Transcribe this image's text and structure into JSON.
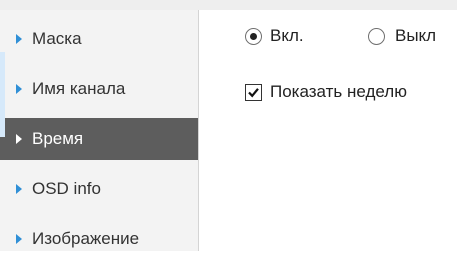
{
  "sidebar": {
    "items": [
      {
        "label": "Маска",
        "active": false
      },
      {
        "label": "Имя канала",
        "active": false
      },
      {
        "label": "Время",
        "active": true
      },
      {
        "label": "OSD info",
        "active": false
      },
      {
        "label": "Изображение",
        "active": false
      }
    ]
  },
  "time_settings": {
    "display_on_label": "Вкл.",
    "display_off_label": "Выкл",
    "display_selected": "on",
    "show_week_label": "Показать неделю",
    "show_week_checked": true
  },
  "colors": {
    "active_item_bg": "#5d5d5d",
    "arrow_accent": "#2f8fd6"
  }
}
